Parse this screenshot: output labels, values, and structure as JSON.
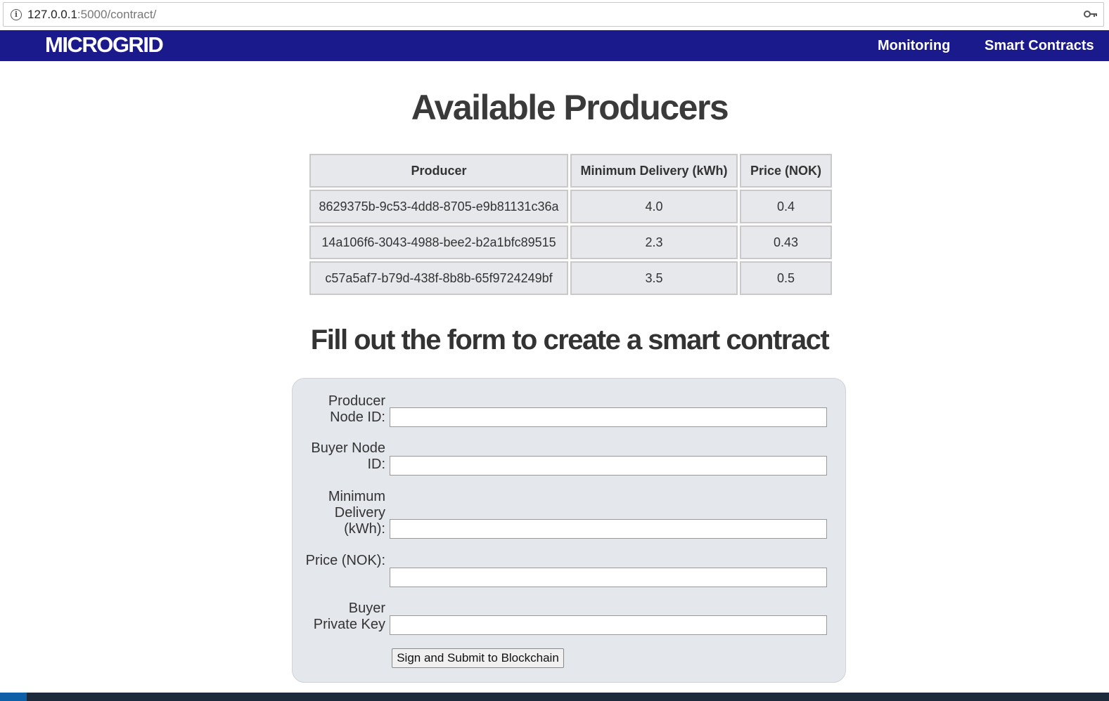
{
  "browser": {
    "url_host": "127.0.0.1",
    "url_rest": ":5000/contract/"
  },
  "navbar": {
    "brand": "MICROGRID",
    "links": [
      "Monitoring",
      "Smart Contracts"
    ]
  },
  "main": {
    "title": "Available Producers",
    "table": {
      "headers": [
        "Producer",
        "Minimum Delivery (kWh)",
        "Price (NOK)"
      ],
      "rows": [
        [
          "8629375b-9c53-4dd8-8705-e9b81131c36a",
          "4.0",
          "0.4"
        ],
        [
          "14a106f6-3043-4988-bee2-b2a1bfc89515",
          "2.3",
          "0.43"
        ],
        [
          "c57a5af7-b79d-438f-8b8b-65f9724249bf",
          "3.5",
          "0.5"
        ]
      ]
    },
    "form_title": "Fill out the form to create a smart contract",
    "form": {
      "fields": [
        {
          "label": "Producer Node ID:",
          "value": ""
        },
        {
          "label": "Buyer Node ID:",
          "value": ""
        },
        {
          "label": "Minimum Delivery (kWh):",
          "value": ""
        },
        {
          "label": "Price (NOK):",
          "value": ""
        },
        {
          "label": "Buyer Private Key",
          "value": ""
        }
      ],
      "submit_label": "Sign and Submit to Blockchain"
    }
  }
}
